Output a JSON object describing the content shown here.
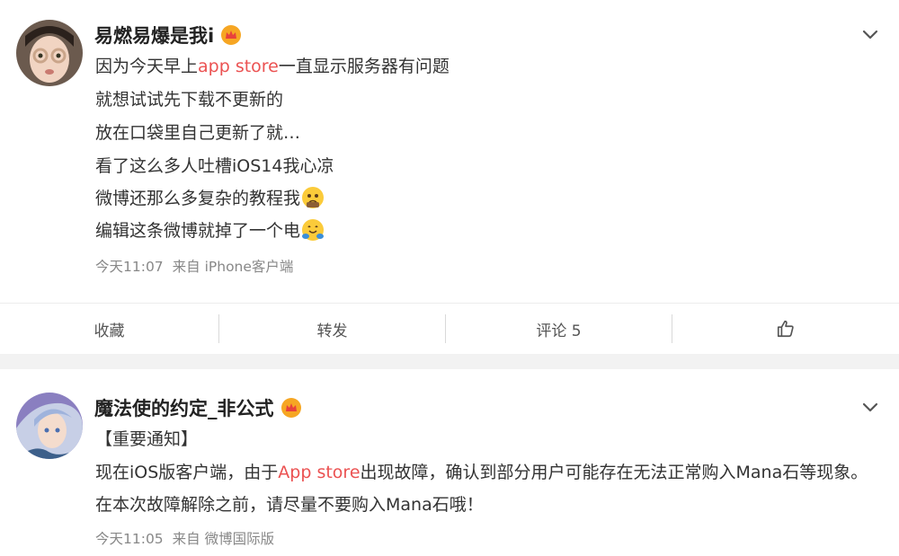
{
  "post1": {
    "username": "易燃易爆是我i",
    "lines": [
      {
        "pre": "因为今天早上",
        "link": "app store",
        "post": "一直显示服务器有问题"
      },
      {
        "text": "就想试试先下载不更新的"
      },
      {
        "text": "放在口袋里自己更新了就…"
      },
      {
        "text": "看了这么多人吐槽iOS14我心凉"
      },
      {
        "text": "微博还那么多复杂的教程我"
      },
      {
        "text": "编辑这条微博就掉了一个电"
      }
    ],
    "time": "今天11:07",
    "source": "来自 iPhone客户端",
    "actions": {
      "favorite": "收藏",
      "repost": "转发",
      "comment": "评论 5"
    }
  },
  "post2": {
    "username": "魔法使的约定_非公式",
    "notice": "【重要通知】",
    "body_pre": "现在iOS版客户端，由于",
    "body_link": "App store",
    "body_post": "出现故障，确认到部分用户可能存在无法正常购入Mana石等现象。在本次故障解除之前，请尽量不要购入Mana石哦！",
    "time": "今天11:05",
    "source": "来自 微博国际版"
  },
  "icons": {
    "vip_badge": "crown-badge-icon",
    "menu": "chevron-down-icon",
    "like": "thumbs-up-icon",
    "emoji1": "pleading-face-icon",
    "emoji2": "hugging-face-icon"
  },
  "colors": {
    "link": "#eb5252",
    "background": "#f2f2f2",
    "card": "#ffffff",
    "meta": "#888888"
  }
}
